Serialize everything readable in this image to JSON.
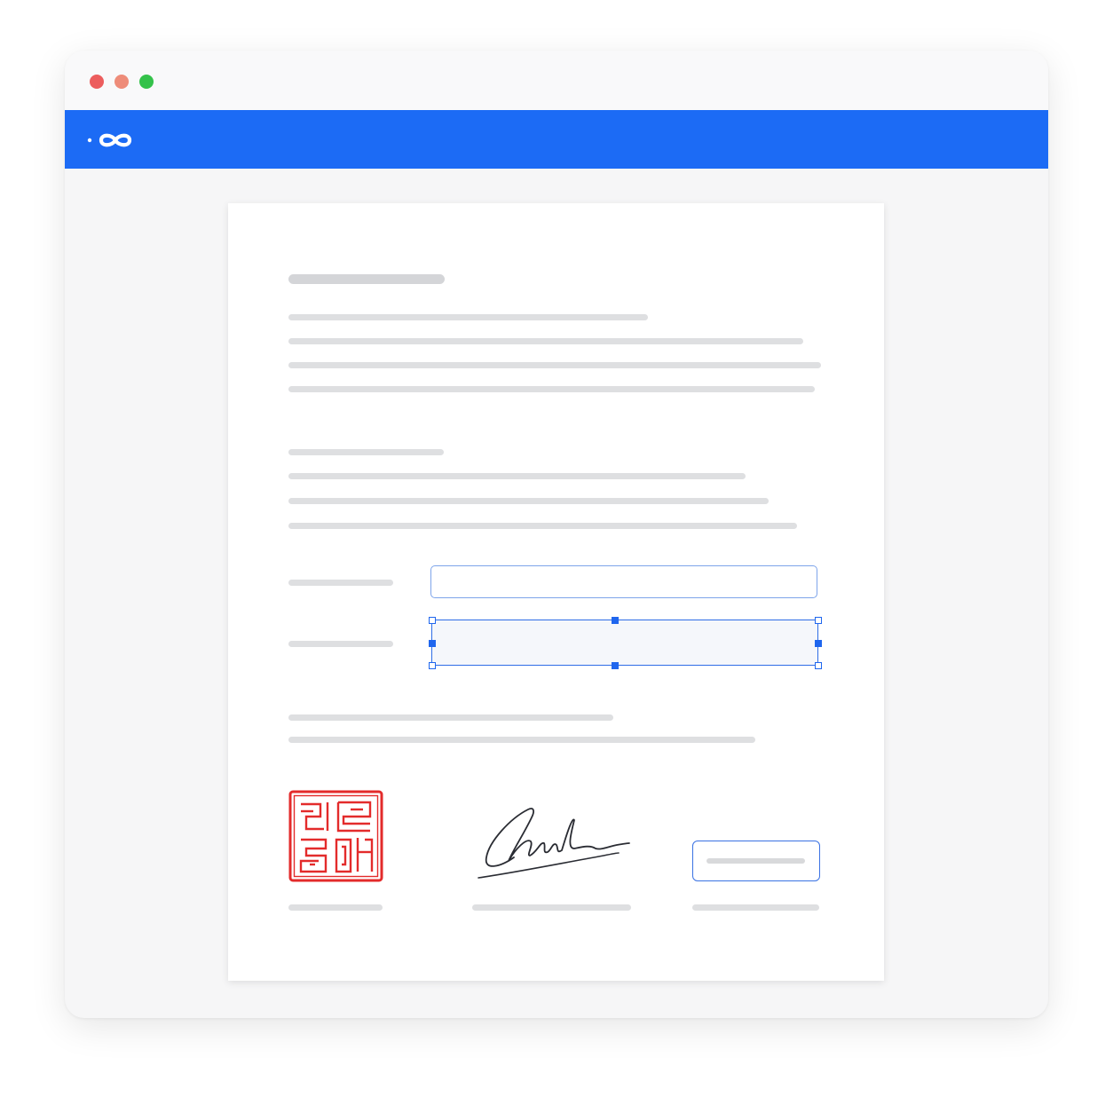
{
  "window": {
    "controls": [
      {
        "name": "close",
        "color": "#ec5d5d"
      },
      {
        "name": "minimize",
        "color": "#ee8c79"
      },
      {
        "name": "maximize",
        "color": "#34c24a"
      }
    ]
  },
  "appbar": {
    "background": "#1c6bf5",
    "logo_icon": "infinity-logo-icon"
  },
  "document": {
    "seal_color": "#e32b2b",
    "signature_icon": "handwritten-signature",
    "selected_field_handles": 8
  }
}
